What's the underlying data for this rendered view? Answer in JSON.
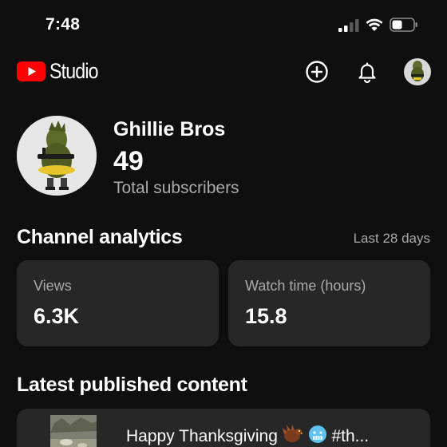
{
  "status_bar": {
    "time": "7:48"
  },
  "header": {
    "logo_text": "Studio",
    "brand_color": "#ff0000",
    "icons": [
      "create-icon",
      "bell-icon",
      "account-avatar"
    ]
  },
  "channel": {
    "name": "Ghillie Bros",
    "subscriber_count": "49",
    "subscriber_label": "Total subscribers"
  },
  "analytics": {
    "title": "Channel analytics",
    "period": "Last 28 days",
    "metrics": [
      {
        "label": "Views",
        "value": "6.3K"
      },
      {
        "label": "Watch time (hours)",
        "value": "15.8"
      }
    ]
  },
  "latest": {
    "title": "Latest published content",
    "video_title_text": "Happy Thanksgiving",
    "video_title_suffix": "#th..."
  }
}
